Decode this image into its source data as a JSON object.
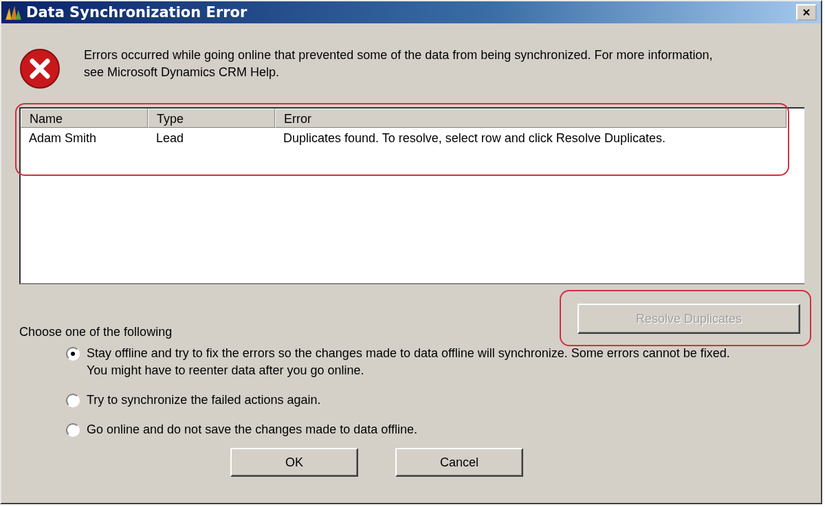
{
  "window": {
    "title": "Data Synchronization Error"
  },
  "message": "Errors occurred while going online that prevented some of the data from being synchronized. For more information, see Microsoft Dynamics CRM Help.",
  "table": {
    "columns": [
      "Name",
      "Type",
      "Error"
    ],
    "rows": [
      {
        "cells": [
          "Adam Smith",
          "Lead",
          "Duplicates found. To resolve, select row and click Resolve Duplicates."
        ],
        "selected": false
      }
    ]
  },
  "resolve_button": {
    "label": "Resolve Duplicates",
    "disabled": true
  },
  "prompt": "Choose one of the following",
  "options": [
    {
      "label": "Stay offline and try to fix the errors so the changes made to data offline will synchronize. Some errors cannot be fixed. You might have to reenter data after you go online.",
      "selected": true
    },
    {
      "label": "Try to synchronize the failed actions again.",
      "selected": false
    },
    {
      "label": "Go online and do not save the changes made to data offline.",
      "selected": false
    }
  ],
  "buttons": [
    "OK",
    "Cancel"
  ]
}
